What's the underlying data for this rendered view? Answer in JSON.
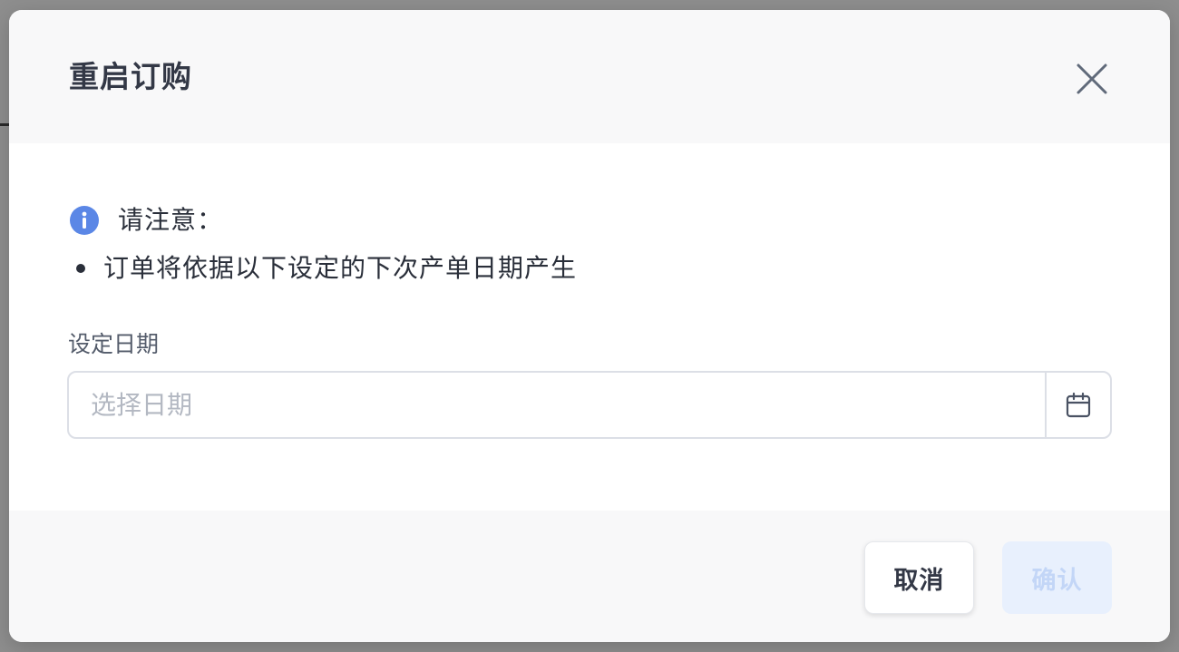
{
  "dialog": {
    "title": "重启订购",
    "close_icon": "close-icon"
  },
  "notice": {
    "icon": "info-icon",
    "icon_color": "#5b87e6",
    "title": "请注意：",
    "items": [
      "订单将依据以下设定的下次产单日期产生"
    ]
  },
  "date_field": {
    "label": "设定日期",
    "placeholder": "选择日期",
    "value": "",
    "icon": "calendar-icon"
  },
  "footer": {
    "cancel_label": "取消",
    "confirm_label": "确认",
    "confirm_disabled": true
  },
  "colors": {
    "primary_disabled_bg": "#e8f0fd",
    "primary_disabled_text": "#c3d6f7",
    "header_bg": "#f8f8f9"
  }
}
